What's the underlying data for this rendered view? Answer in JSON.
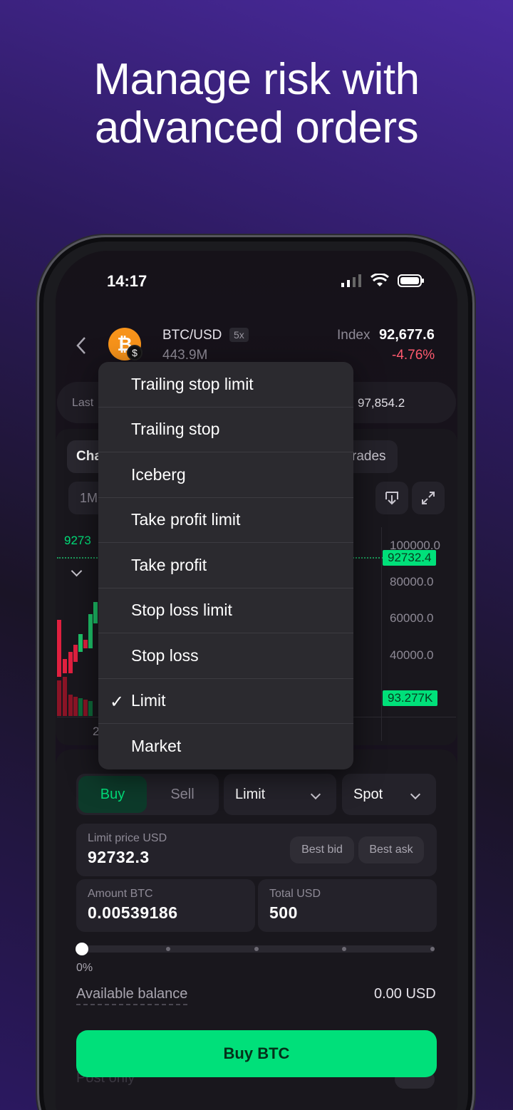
{
  "headline": {
    "line1": "Manage risk with",
    "line2": "advanced orders"
  },
  "status_bar": {
    "time": "14:17"
  },
  "header": {
    "pair": "BTC/USD",
    "leverage": "5x",
    "volume": "443.9M",
    "index_label": "Index",
    "index_value": "92,677.6",
    "change": "-4.76%"
  },
  "stats_row": {
    "last_label": "Last",
    "right_value": "97,854.2"
  },
  "tabs": {
    "chart_partial": "Cha",
    "trades_partial": "rades"
  },
  "timeframe_partial": "1M",
  "chart": {
    "price_left_partial": "9273",
    "y_ticks": [
      "100000.0",
      "80000.0",
      "60000.0",
      "40000.0"
    ],
    "price_tag": "92732.4",
    "volume_tag": "93.277K",
    "x_partial": "2"
  },
  "order_type_menu": {
    "items": [
      "Trailing stop limit",
      "Trailing stop",
      "Iceberg",
      "Take profit limit",
      "Take profit",
      "Stop loss limit",
      "Stop loss",
      "Limit",
      "Market"
    ],
    "selected": "Limit"
  },
  "order_form": {
    "buy_label": "Buy",
    "sell_label": "Sell",
    "order_type": "Limit",
    "market_type": "Spot",
    "limit_price_label": "Limit price USD",
    "limit_price_value": "92732.3",
    "best_bid": "Best bid",
    "best_ask": "Best ask",
    "amount_label": "Amount BTC",
    "amount_value": "0.00539186",
    "total_label": "Total USD",
    "total_value": "500",
    "slider_percent": "0%",
    "available_label": "Available balance",
    "available_value": "0.00 USD",
    "post_only_label": "Post only",
    "submit_label": "Buy BTC"
  },
  "colors": {
    "accent_green": "#00e07a",
    "negative_red": "#ff5a6e",
    "menu_bg": "#2b2a2f"
  }
}
